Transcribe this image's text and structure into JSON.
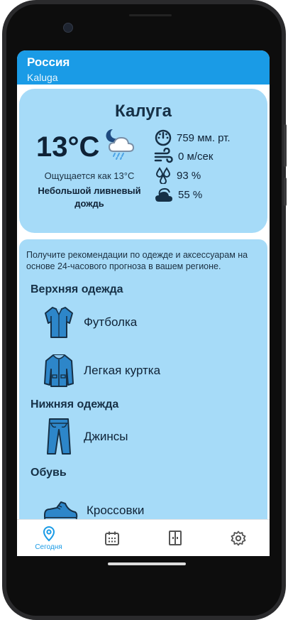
{
  "app": {
    "country": "Россия",
    "city_latin": "Kaluga"
  },
  "weather": {
    "city": "Калуга",
    "temperature": "13°C",
    "feels_like": "Ощущается как 13°C",
    "description": "Небольшой ливневый дождь",
    "icon": "partly-cloudy-night-rain-icon",
    "stats": [
      {
        "icon": "pressure-gauge-icon",
        "value": "759 мм. рт."
      },
      {
        "icon": "wind-icon",
        "value": " 0 м/сек"
      },
      {
        "icon": "humidity-drops-icon",
        "value": "93 %"
      },
      {
        "icon": "cloudiness-icon",
        "value": "55 %"
      }
    ]
  },
  "recommendations": {
    "intro": "Получите рекомендации по одежде и аксессуарам на основе 24-часового прогноза в вашем регионе.",
    "categories": {
      "outerwear": "Верхняя одежда",
      "bottoms": "Нижняя одежда",
      "footwear": "Обувь"
    },
    "items": {
      "tshirt": "Футболка",
      "light_jacket": "Легкая куртка",
      "jeans": "Джинсы",
      "sneakers": "Кроссовки"
    }
  },
  "nav": {
    "today": "Сегодня",
    "items": [
      "location-pin-icon",
      "calendar-icon",
      "wardrobe-icon",
      "settings-gear-icon"
    ]
  },
  "colors": {
    "accent": "#1a9be6",
    "card": "#a6dbf8",
    "text_dark": "#0f2236"
  }
}
